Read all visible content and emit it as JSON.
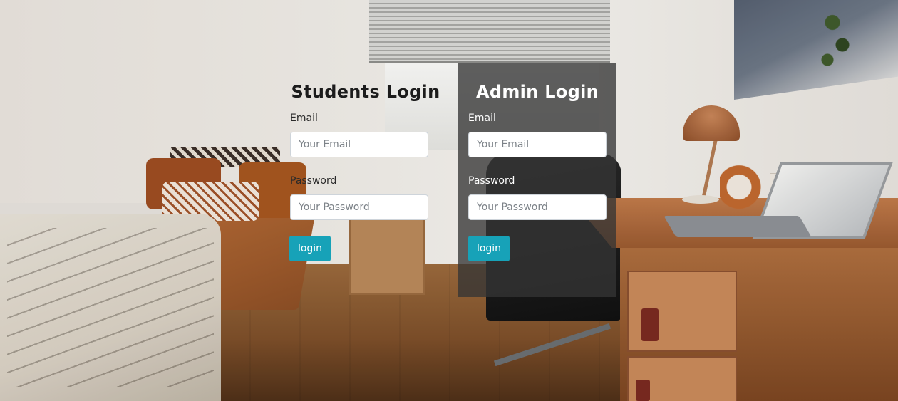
{
  "students_login": {
    "title": "Students Login",
    "email_label": "Email",
    "email_placeholder": "Your Email",
    "email_value": "",
    "password_label": "Password",
    "password_placeholder": "Your Password",
    "password_value": "",
    "submit_label": "login"
  },
  "admin_login": {
    "title": "Admin Login",
    "email_label": "Email",
    "email_placeholder": "Your Email",
    "email_value": "",
    "password_label": "Password",
    "password_placeholder": "Your Password",
    "password_value": "",
    "submit_label": "login"
  },
  "colors": {
    "button_accent": "#17a2b8",
    "admin_panel_overlay": "#343434"
  },
  "background": {
    "description_icon": "bedroom-photo"
  }
}
